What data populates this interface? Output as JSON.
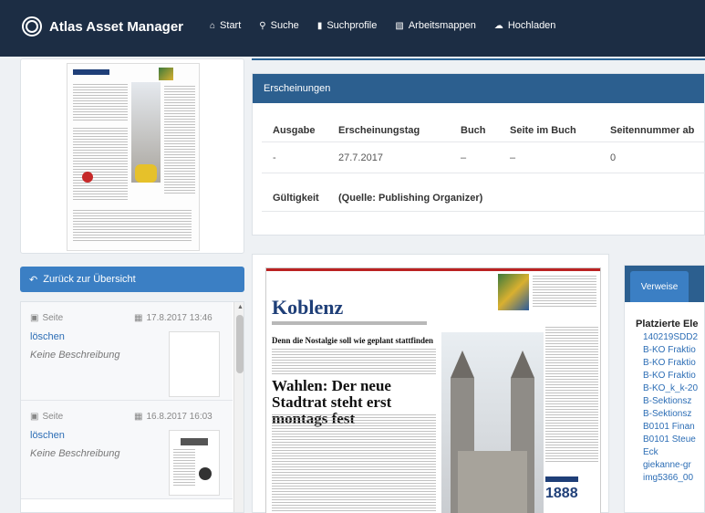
{
  "app": {
    "brand": "Atlas Asset Manager"
  },
  "nav": {
    "items": [
      {
        "label": "Start",
        "icon": "home-icon"
      },
      {
        "label": "Suche",
        "icon": "search-icon"
      },
      {
        "label": "Suchprofile",
        "icon": "bookmark-icon"
      },
      {
        "label": "Arbeitsmappen",
        "icon": "folder-icon"
      },
      {
        "label": "Hochladen",
        "icon": "upload-icon"
      }
    ]
  },
  "sidebar": {
    "back_label": "Zurück zur Übersicht",
    "history": [
      {
        "kind": "Seite",
        "date": "17.8.2017 13:46",
        "delete_label": "löschen",
        "description": "Keine Beschreibung"
      },
      {
        "kind": "Seite",
        "date": "16.8.2017 16:03",
        "delete_label": "löschen",
        "description": "Keine Beschreibung"
      }
    ]
  },
  "publications": {
    "title": "Erscheinungen",
    "headers": [
      "Ausgabe",
      "Erscheinungstag",
      "Buch",
      "Seite im Buch",
      "Seitennummer ab"
    ],
    "row": [
      "-",
      "27.7.2017",
      "–",
      "–",
      "0"
    ],
    "validity_label": "Gültigkeit",
    "validity_source": "(Quelle: Publishing Organizer)"
  },
  "page_preview": {
    "masthead": "Koblenz",
    "headline_small": "Denn die Nostalgie soll wie geplant stattfinden",
    "headline_main": "Wahlen: Der neue Stadtrat steht erst montags fest",
    "badge_number": "1888"
  },
  "refs": {
    "tab_label": "Verweise",
    "heading": "Platzierte Ele",
    "links": [
      "140219SDD2",
      "B-KO Fraktio",
      "B-KO Fraktio",
      "B-KO Fraktio",
      "B-KO_k_k-20",
      "B-Sektionsz",
      "B-Sektionsz",
      "B0101 Finan",
      "B0101 Steue",
      "Eck",
      "giekanne-gr",
      "img5366_00"
    ]
  },
  "colors": {
    "navbar": "#1c2d44",
    "accent": "#3b7fc4",
    "panel_header": "#2c5f8f",
    "link": "#2c6db5"
  }
}
